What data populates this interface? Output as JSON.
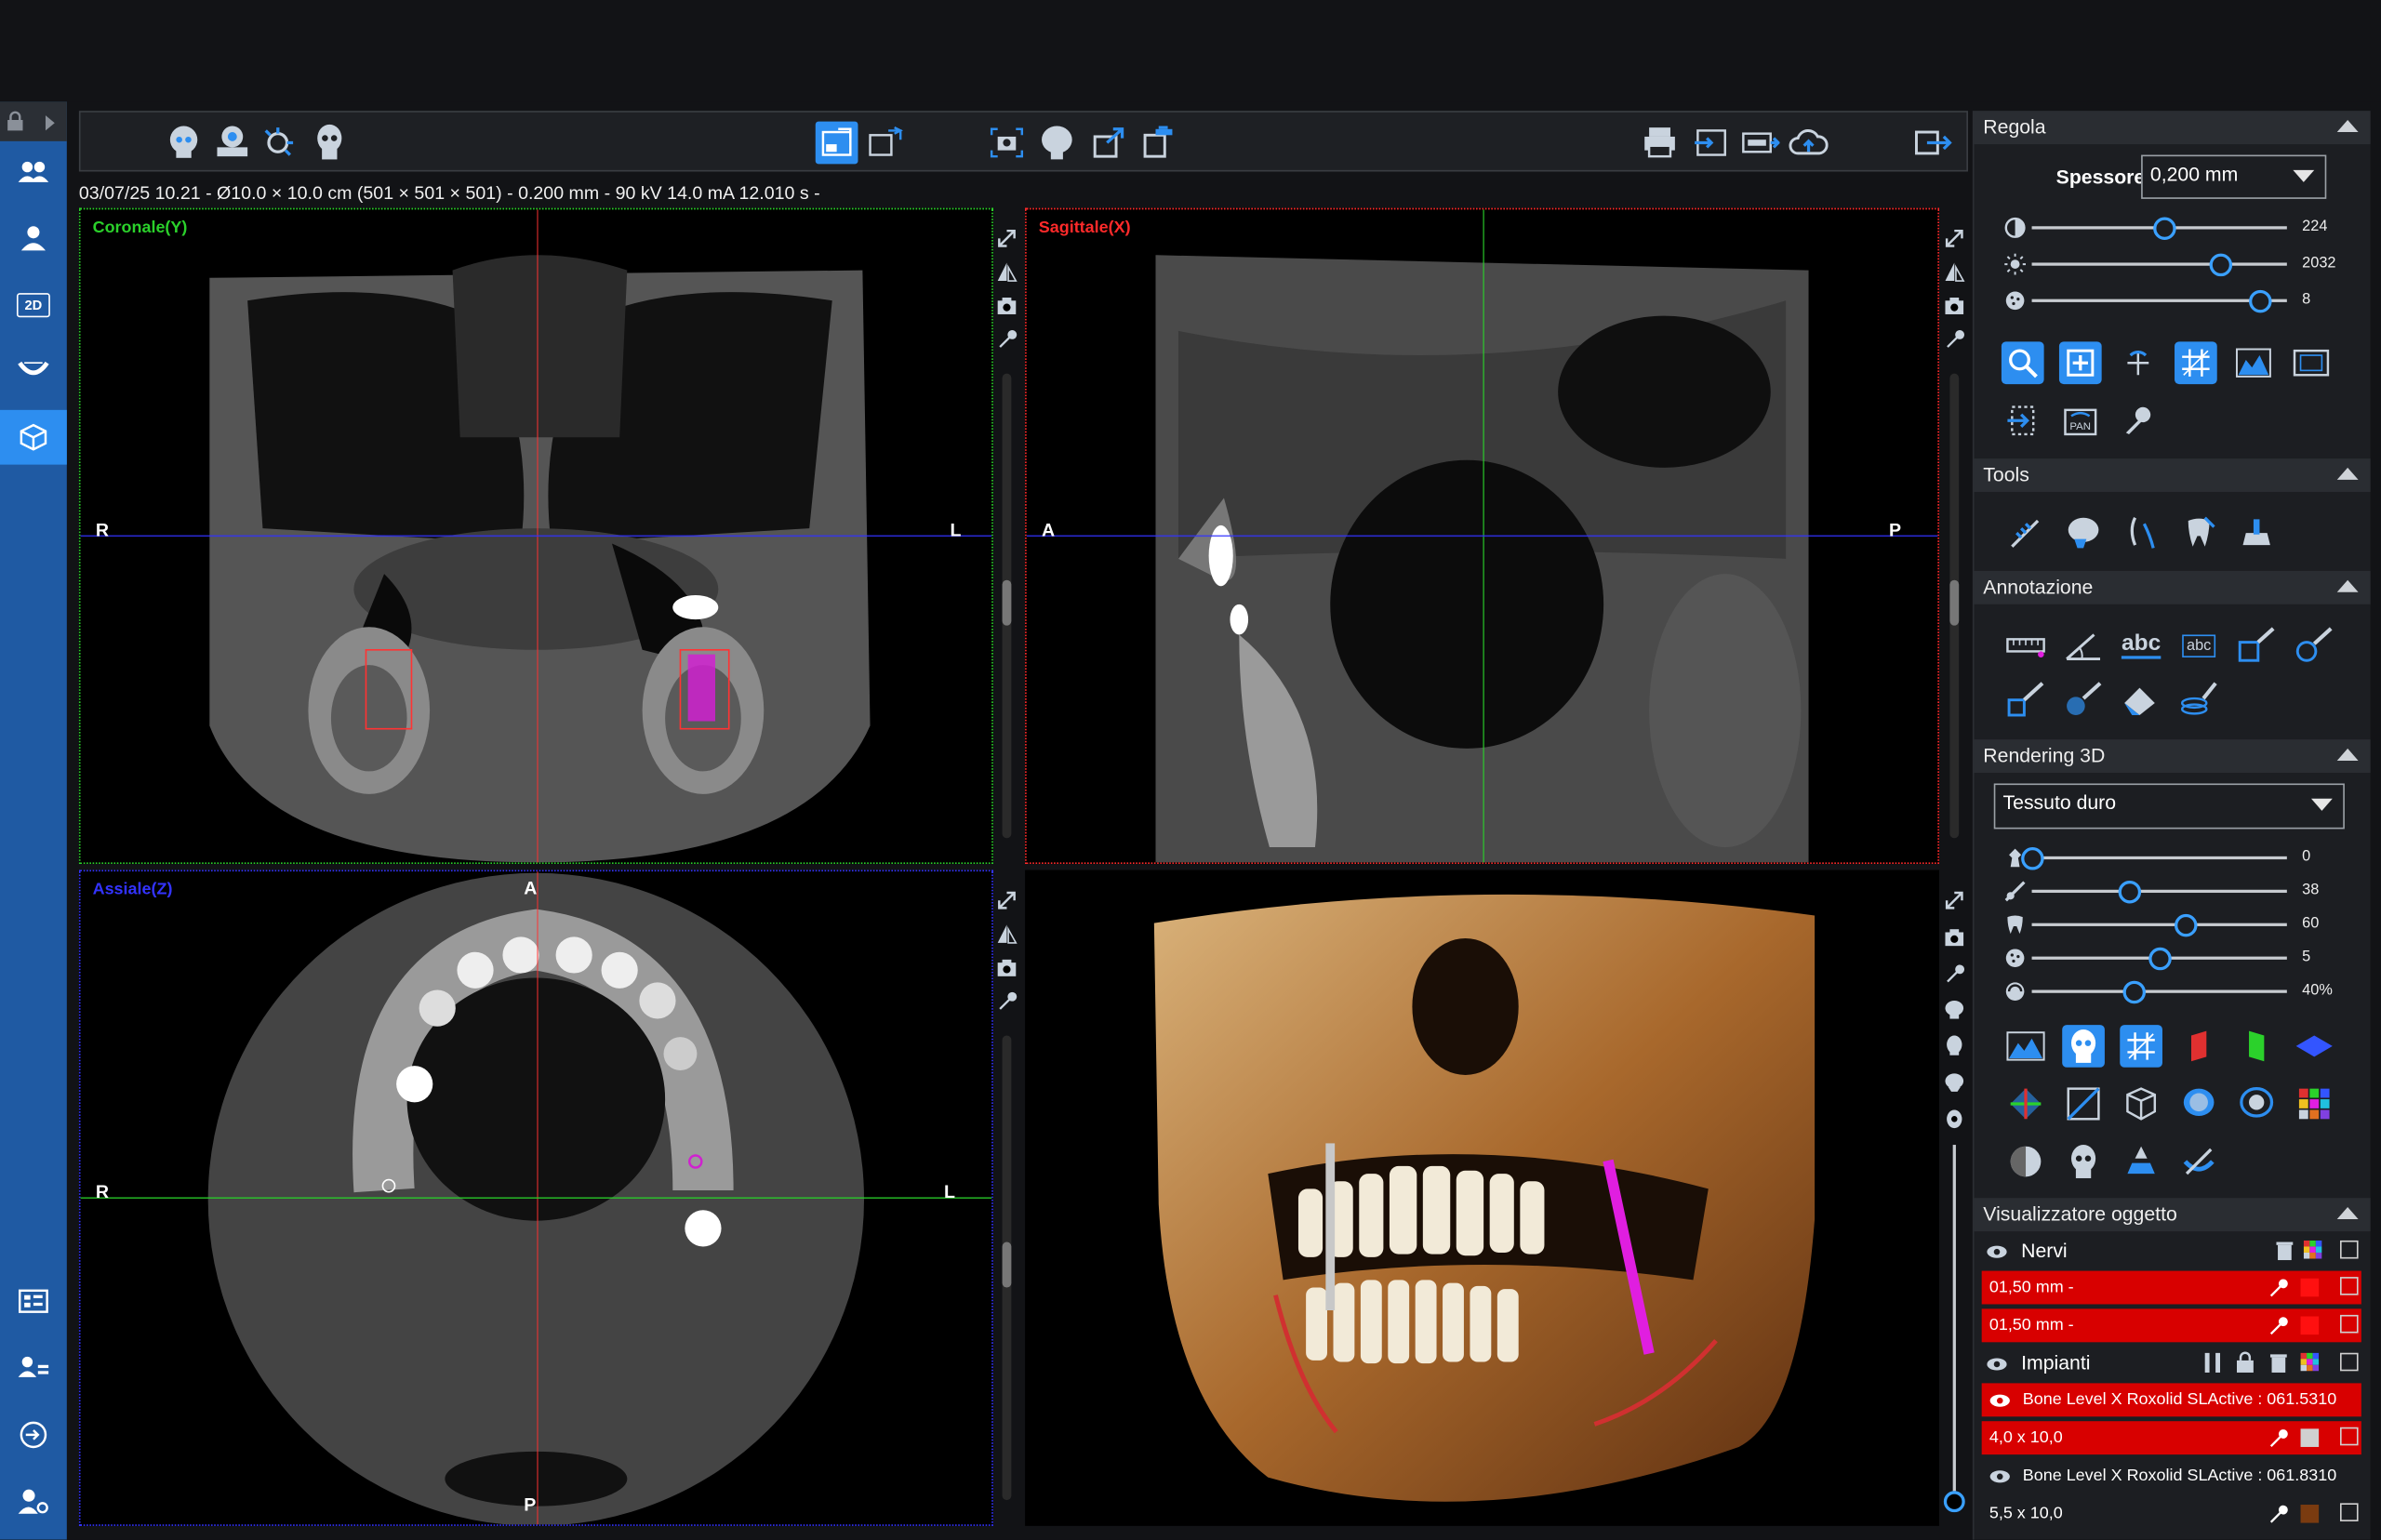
{
  "toolbar_info": "03/07/25 10.21 - Ø10.0 × 10.0 cm (501 × 501 × 501) - 0.200 mm - 90 kV 14.0 mA 12.010 s -",
  "views": {
    "coronal": {
      "label": "Coronale(Y)",
      "left": "R",
      "right": "L"
    },
    "sagittal": {
      "label": "Sagittale(X)",
      "left": "A",
      "right": "P"
    },
    "axial": {
      "label": "Assiale(Z)",
      "left": "R",
      "right": "L",
      "top": "A",
      "bottom": "P"
    }
  },
  "panel": {
    "regola": {
      "title": "Regola",
      "spessore_label": "Spessore",
      "spessore_value": "0,200 mm",
      "sliders": [
        {
          "icon": "contrast-icon",
          "value": "224",
          "fraction": 0.52
        },
        {
          "icon": "brightness-icon",
          "value": "2032",
          "fraction": 0.74
        },
        {
          "icon": "filter-icon",
          "value": "8",
          "fraction": 0.89
        }
      ]
    },
    "tools": {
      "title": "Tools"
    },
    "annotazione": {
      "title": "Annotazione",
      "abc1": "abc",
      "abc2": "abc"
    },
    "rendering": {
      "title": "Rendering 3D",
      "preset": "Tessuto duro",
      "sliders": [
        {
          "icon": "opacity-icon",
          "value": "0",
          "fraction": 0.0
        },
        {
          "icon": "cut-icon",
          "value": "38",
          "fraction": 0.38
        },
        {
          "icon": "tooth-icon",
          "value": "60",
          "fraction": 0.6
        },
        {
          "icon": "filter-icon",
          "value": "5",
          "fraction": 0.5
        },
        {
          "icon": "transparency-icon",
          "value": "40%",
          "fraction": 0.4
        }
      ]
    },
    "visualizzatore": {
      "title": "Visualizzatore oggetto",
      "nervi": "Nervi",
      "nerve1": "01,50 mm -",
      "nerve2": "01,50 mm -",
      "impianti": "Impianti",
      "implant1_name": "Bone Level X Roxolid SLActive : 061.5310",
      "implant1_size": "4,0 x 10,0",
      "implant2_name": "Bone Level X Roxolid SLActive : 061.8310",
      "implant2_size": "5,5 x 10,0"
    }
  },
  "left_nav": {
    "nav_2d": "2D"
  },
  "colors": {
    "accent": "#2d8ef0",
    "nav_bg": "#1f5aa3",
    "coronal_label": "#2bd12b",
    "sagittal_label": "#ff2a2a",
    "axial_label": "#3333ff",
    "implant_red": "#d80000",
    "implant2_swatch": "#7a3b10"
  }
}
